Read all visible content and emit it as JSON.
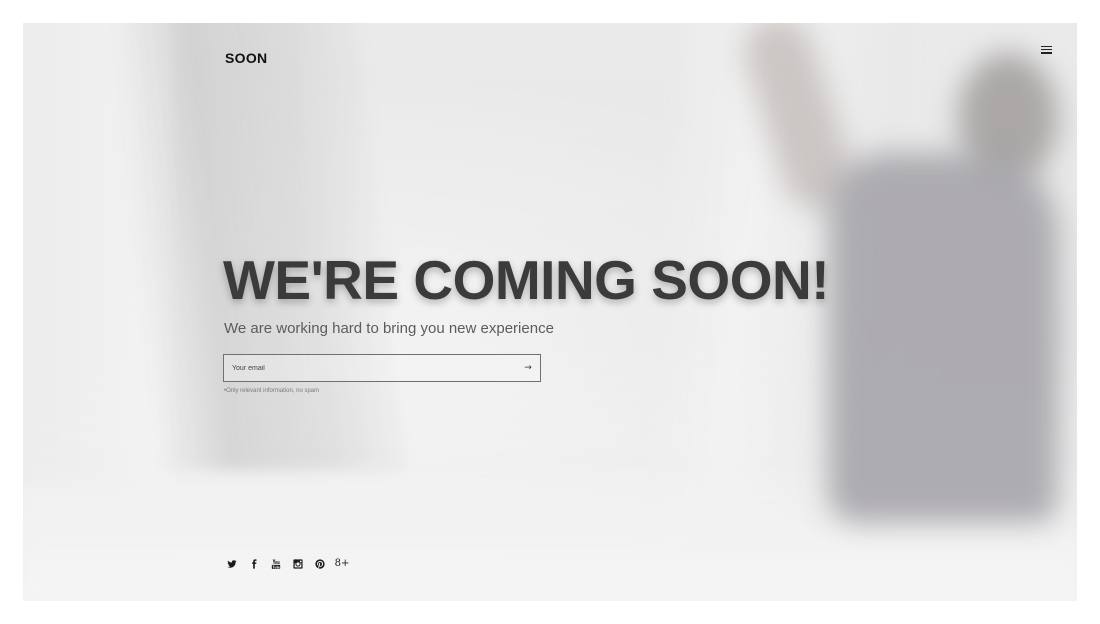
{
  "header": {
    "logo": "SOON",
    "menu_icon": "hamburger-menu-icon"
  },
  "hero": {
    "title": "WE'RE COMING SOON!",
    "subtitle": "We are working hard to bring you new experience"
  },
  "signup": {
    "email_placeholder": "Your email",
    "email_value": "",
    "submit_label": "→",
    "note": "•Only relevant information, no spam"
  },
  "social": {
    "icons": [
      "twitter-icon",
      "facebook-icon",
      "youtube-icon",
      "instagram-icon",
      "pinterest-icon",
      "google-plus-icon"
    ],
    "google_plus_glyph": "8+"
  },
  "colors": {
    "headline": "#3b3b3b",
    "text": "#5c5c5c",
    "border": "#707070"
  }
}
